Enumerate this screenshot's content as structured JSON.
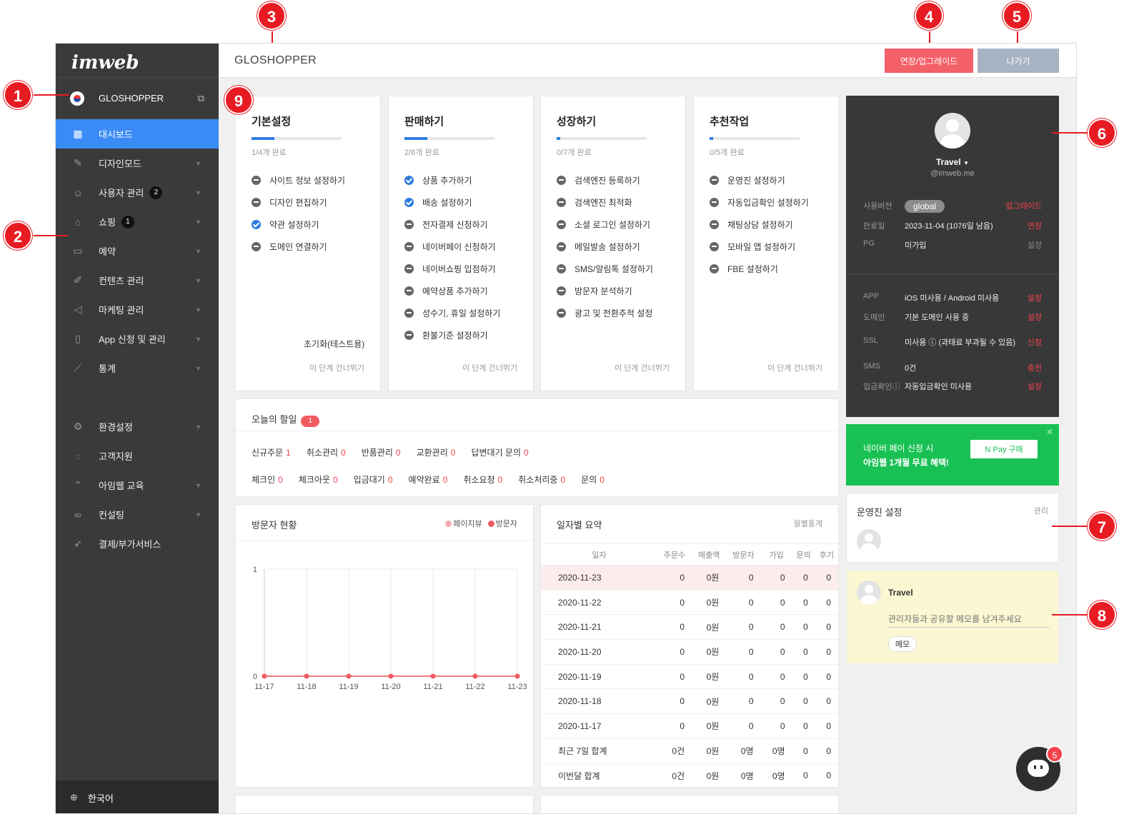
{
  "sidebar": {
    "logo": "imweb",
    "site_name": "GLOSHOPPER",
    "items": [
      {
        "label": "대시보드",
        "icon": "dashboard-icon",
        "badge": ""
      },
      {
        "label": "디자인모드",
        "icon": "brush-icon",
        "badge": ""
      },
      {
        "label": "사용자 관리",
        "icon": "user-icon",
        "badge": "2"
      },
      {
        "label": "쇼핑",
        "icon": "shopping-bag-icon",
        "badge": "1"
      },
      {
        "label": "예약",
        "icon": "calendar-icon",
        "badge": ""
      },
      {
        "label": "컨텐츠 관리",
        "icon": "edit-icon",
        "badge": ""
      },
      {
        "label": "마케팅 관리",
        "icon": "megaphone-icon",
        "badge": ""
      },
      {
        "label": "App 신청 및 관리",
        "icon": "mobile-icon",
        "badge": ""
      },
      {
        "label": "통계",
        "icon": "chart-icon",
        "badge": ""
      },
      {
        "label": "환경설정",
        "icon": "gear-icon",
        "badge": ""
      },
      {
        "label": "고객지원",
        "icon": "chat-icon",
        "badge": ""
      },
      {
        "label": "아임웹 교육",
        "icon": "graduation-icon",
        "badge": ""
      },
      {
        "label": "컨설팅",
        "icon": "glasses-icon",
        "badge": ""
      },
      {
        "label": "결제/부가서비스",
        "icon": "rocket-icon",
        "badge": ""
      }
    ],
    "language": "한국어"
  },
  "header": {
    "title": "GLOSHOPPER",
    "upgrade_label": "연장/업그레이드",
    "exit_label": "나가기"
  },
  "steps": [
    {
      "title": "기본설정",
      "progress": "1/4개 완료",
      "fraction": 0.25,
      "tasks": [
        {
          "label": "사이트 정보 설정하기",
          "done": false
        },
        {
          "label": "디자인 편집하기",
          "done": false
        },
        {
          "label": "약관 설정하기",
          "done": true
        },
        {
          "label": "도메인 연결하기",
          "done": false
        }
      ],
      "reset": "초기화(테스트용)",
      "skip": "이 단계 건너뛰기"
    },
    {
      "title": "판매하기",
      "progress": "2/8개 완료",
      "fraction": 0.25,
      "tasks": [
        {
          "label": "상품 추가하기",
          "done": true
        },
        {
          "label": "배송 설정하기",
          "done": true
        },
        {
          "label": "전자결제 신청하기",
          "done": false
        },
        {
          "label": "네이버페이 신청하기",
          "done": false
        },
        {
          "label": "네이버쇼핑 입점하기",
          "done": false
        },
        {
          "label": "예약상품 추가하기",
          "done": false
        },
        {
          "label": "성수기, 휴일 설정하기",
          "done": false
        },
        {
          "label": "환불기준 설정하기",
          "done": false
        }
      ],
      "skip": "이 단계 건너뛰기"
    },
    {
      "title": "성장하기",
      "progress": "0/7개 완료",
      "fraction": 0.04,
      "tasks": [
        {
          "label": "검색엔진 등록하기",
          "done": false
        },
        {
          "label": "검색엔진 최적화",
          "done": false
        },
        {
          "label": "소셜 로그인 설정하기",
          "done": false
        },
        {
          "label": "메일발송 설정하기",
          "done": false
        },
        {
          "label": "SMS/알림톡 설정하기",
          "done": false
        },
        {
          "label": "방문자 분석하기",
          "done": false
        },
        {
          "label": "광고 및 전환추적 설정",
          "done": false
        }
      ],
      "skip": "이 단계 건너뛰기"
    },
    {
      "title": "추천작업",
      "progress": "0/5개 완료",
      "fraction": 0.04,
      "tasks": [
        {
          "label": "운영진 설정하기",
          "done": false
        },
        {
          "label": "자동입금확인 설정하기",
          "done": false
        },
        {
          "label": "채팅상담 설정하기",
          "done": false
        },
        {
          "label": "모바일 앱 설정하기",
          "done": false
        },
        {
          "label": "FBE 설정하기",
          "done": false
        }
      ],
      "skip": "이 단계 건너뛰기"
    }
  ],
  "todo": {
    "title": "오늘의 할일",
    "count": "1",
    "row1": [
      {
        "label": "신규주문",
        "value": "1"
      },
      {
        "label": "취소관리",
        "value": "0"
      },
      {
        "label": "반품관리",
        "value": "0"
      },
      {
        "label": "교환관리",
        "value": "0"
      },
      {
        "label": "답변대기 문의",
        "value": "0"
      }
    ],
    "row2": [
      {
        "label": "체크인",
        "value": "0"
      },
      {
        "label": "체크아웃",
        "value": "0"
      },
      {
        "label": "입금대기",
        "value": "0"
      },
      {
        "label": "예약완료",
        "value": "0"
      },
      {
        "label": "취소요청",
        "value": "0"
      },
      {
        "label": "취소처리중",
        "value": "0"
      },
      {
        "label": "문의",
        "value": "0"
      }
    ]
  },
  "visitors": {
    "title": "방문자 현황",
    "legend_pageview": "페이지뷰",
    "legend_visitor": "방문자"
  },
  "chart_data": {
    "type": "line",
    "categories": [
      "11-17",
      "11-18",
      "11-19",
      "11-20",
      "11-21",
      "11-22",
      "11-23"
    ],
    "series": [
      {
        "name": "페이지뷰",
        "values": [
          0,
          0,
          0,
          0,
          0,
          0,
          0
        ],
        "color": "#f7a8ad"
      },
      {
        "name": "방문자",
        "values": [
          0,
          0,
          0,
          0,
          0,
          0,
          0
        ],
        "color": "#f15b64"
      }
    ],
    "ylim": [
      0,
      1
    ],
    "yticks": [
      "0",
      "1"
    ],
    "grid": true
  },
  "summary": {
    "title": "일자별 요약",
    "monthly": "월별통계",
    "columns": [
      "일자",
      "주문수",
      "매출액",
      "방문자",
      "가입",
      "문의",
      "후기"
    ],
    "rows": [
      [
        "2020-11-23",
        "0",
        "0원",
        "0",
        "0",
        "0",
        "0"
      ],
      [
        "2020-11-22",
        "0",
        "0원",
        "0",
        "0",
        "0",
        "0"
      ],
      [
        "2020-11-21",
        "0",
        "0원",
        "0",
        "0",
        "0",
        "0"
      ],
      [
        "2020-11-20",
        "0",
        "0원",
        "0",
        "0",
        "0",
        "0"
      ],
      [
        "2020-11-19",
        "0",
        "0원",
        "0",
        "0",
        "0",
        "0"
      ],
      [
        "2020-11-18",
        "0",
        "0원",
        "0",
        "0",
        "0",
        "0"
      ],
      [
        "2020-11-17",
        "0",
        "0원",
        "0",
        "0",
        "0",
        "0"
      ],
      [
        "최근 7일 합계",
        "0건",
        "0원",
        "0명",
        "0명",
        "0",
        "0"
      ],
      [
        "이번달 합계",
        "0건",
        "0원",
        "0명",
        "0명",
        "0",
        "0"
      ]
    ]
  },
  "profile": {
    "name": "Travel",
    "email": "@imweb.me",
    "version_label": "사용버전",
    "version": "global",
    "upgrade": "업그레이드",
    "expire_label": "만료일",
    "expire": "2023-11-04 (1076일 남음)",
    "extend": "연장",
    "pg_label": "PG",
    "pg": "미가입",
    "pg_action": "설정",
    "app_label": "APP",
    "app": "iOS 미사용 / Android 미사용",
    "app_action": "설정",
    "domain_label": "도메인",
    "domain": "기본 도메인 사용 중",
    "domain_action": "설정",
    "ssl_label": "SSL",
    "ssl": "미사용 ⓘ (과태료 부과될 수 있음)",
    "ssl_action": "신청",
    "sms_label": "SMS",
    "sms": "0건",
    "sms_action": "충전",
    "deposit_label": "입금확인ⓘ",
    "deposit": "자동입금확인 미사용",
    "deposit_action": "설정"
  },
  "naver": {
    "line1": "네이버 페이 신청 시",
    "line2": "아임웹 1개월 무료 혜택!",
    "button": "N Pay 구매"
  },
  "staff": {
    "title": "운영진 설정",
    "manage": "관리"
  },
  "memo": {
    "name": "Travel",
    "placeholder": "관리자들과 공유할 메모를 남겨주세요",
    "button": "메모"
  },
  "chat": {
    "badge": "5"
  },
  "callouts": [
    "1",
    "2",
    "3",
    "4",
    "5",
    "6",
    "7",
    "8",
    "9"
  ]
}
